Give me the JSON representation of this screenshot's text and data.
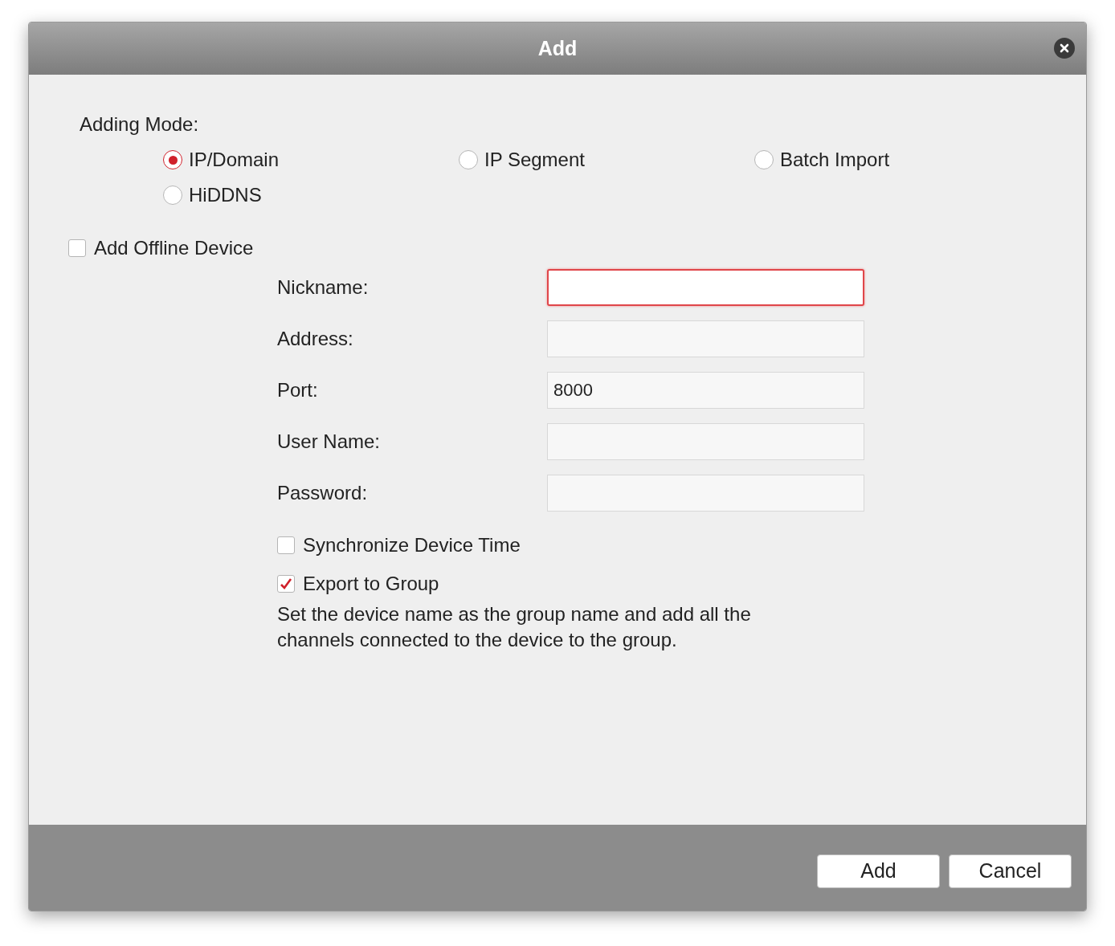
{
  "window": {
    "title": "Add"
  },
  "adding_mode": {
    "label": "Adding Mode:",
    "options": [
      {
        "label": "IP/Domain",
        "selected": true
      },
      {
        "label": "IP Segment",
        "selected": false
      },
      {
        "label": "Batch Import",
        "selected": false
      },
      {
        "label": "HiDDNS",
        "selected": false
      }
    ]
  },
  "offline_device": {
    "label": "Add Offline Device",
    "checked": false
  },
  "fields": [
    {
      "label": "Nickname:",
      "focused": true
    },
    {
      "label": "Address:",
      "focused": false
    },
    {
      "label": "Port:",
      "value": "8000",
      "focused": false
    },
    {
      "label": "User Name:",
      "focused": false
    },
    {
      "label": "Password:",
      "focused": false
    }
  ],
  "options": [
    {
      "label": "Synchronize Device Time",
      "checked": false
    },
    {
      "label": "Export to Group",
      "checked": true
    }
  ],
  "description": "Set the device name as the group name and add all the channels connected to the device to the group.",
  "buttons": [
    "Add",
    "Cancel"
  ]
}
